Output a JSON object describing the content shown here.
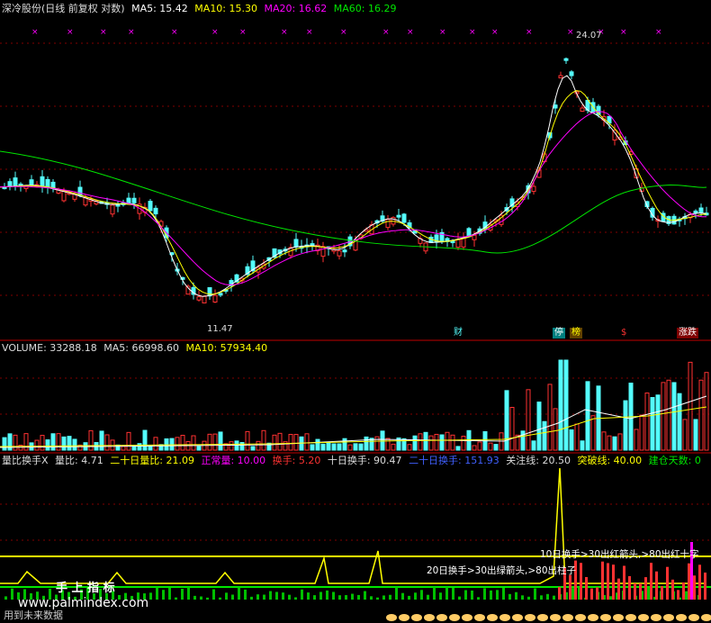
{
  "price_panel": {
    "title": "深冷股份(日线 前复权 对数)",
    "ma5": "MA5: 15.42",
    "ma10": "MA10: 15.30",
    "ma20": "MA20: 16.62",
    "ma60": "MA60: 16.29",
    "high_label": "24.07",
    "low_label": "11.47",
    "events": [
      "财",
      "停",
      "榜",
      "$",
      "涨跌"
    ]
  },
  "volume_panel": {
    "volume": "VOLUME: 33288.18",
    "ma5": "MA5: 66998.60",
    "ma10": "MA10: 57934.40"
  },
  "indicator_panel": {
    "name": "量比换手X",
    "liangbi": "量比: 4.71",
    "liangbi20": "二十日量比: 21.09",
    "normal": "正常量: 10.00",
    "turnover": "换手: 5.20",
    "turnover10": "十日换手: 90.47",
    "turnover20": "二十日换手: 151.93",
    "watch": "关注线: 20.50",
    "breakout": "突破线: 40.00",
    "build_days": "建仓天数: 0",
    "note1": "10日换手>30出红箭头,>80出红十字",
    "note2": "20日换手>30出绿箭头,>80出柱子",
    "watermark_cn": "手 上 指 标",
    "watermark_url": "www.palmindex.com",
    "footer": "用到未来数据"
  },
  "colors": {
    "up": "#ff3232",
    "down": "#54fcfc",
    "ma5": "#ffffff",
    "ma10": "#ffff00",
    "ma20": "#ff00ff",
    "ma60": "#00e600",
    "grid": "#800000"
  }
}
